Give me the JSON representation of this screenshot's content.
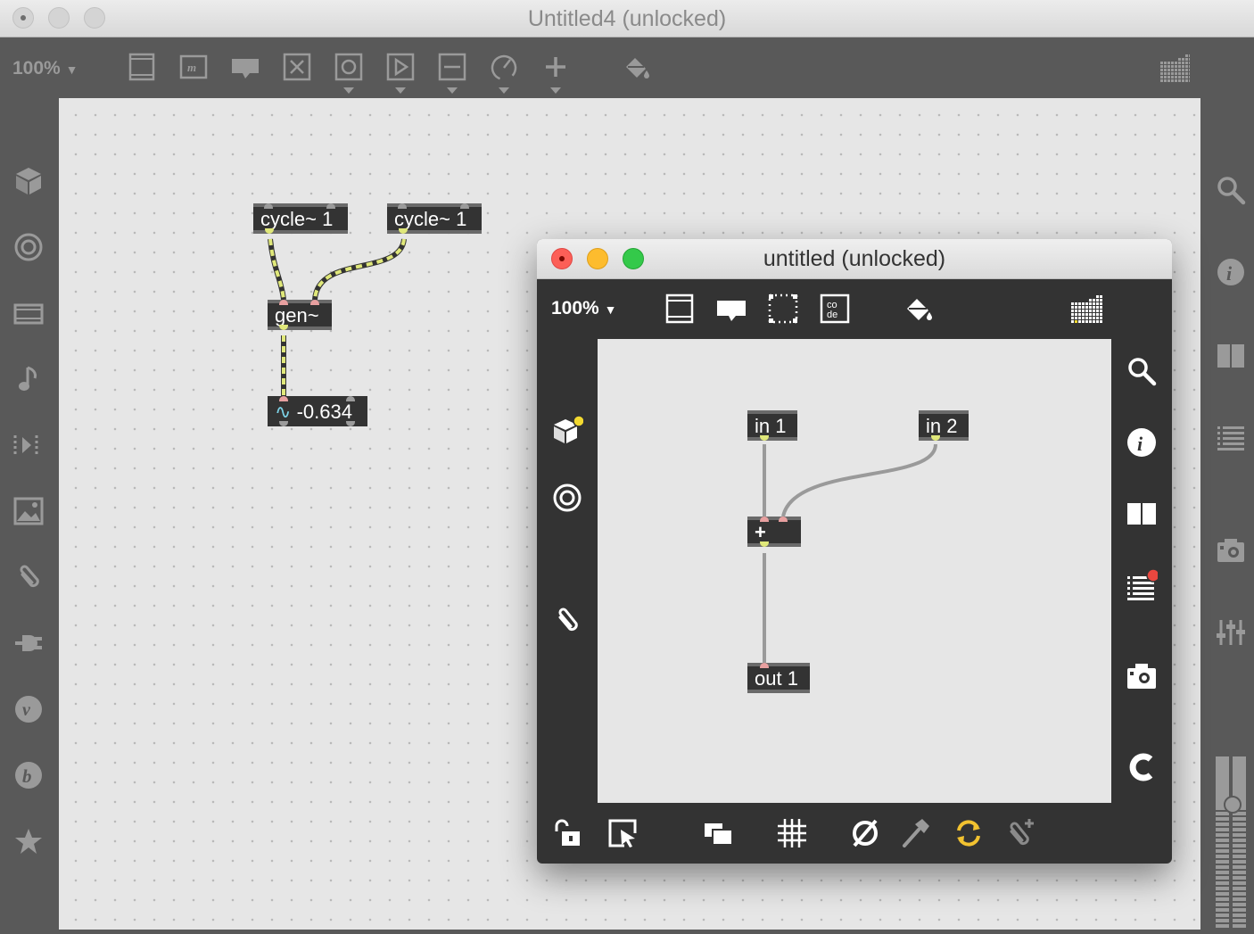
{
  "window": {
    "title": "Untitled4 (unlocked)"
  },
  "toolbar": {
    "zoom": "100%",
    "icons": [
      "presentation-frame-icon",
      "message-box-icon",
      "comment-icon",
      "button-x-icon",
      "toggle-circle-icon",
      "play-icon",
      "slider-icon",
      "dial-icon",
      "plus-icon",
      "paint-bucket-icon",
      "grid-pattern-icon"
    ]
  },
  "left_sidebar": {
    "icons": [
      "cube-icon",
      "target-icon",
      "media-player-icon",
      "music-note-icon",
      "skip-frames-icon",
      "image-icon",
      "paperclip-icon",
      "plug-icon",
      "vst-v-icon",
      "beap-b-icon",
      "star-icon"
    ]
  },
  "right_sidebar": {
    "icons": [
      "search-icon",
      "info-icon",
      "split-view-icon",
      "list-icon",
      "camera-icon",
      "mixer-icon",
      "level-meter-icon"
    ]
  },
  "patch": {
    "objects": [
      {
        "id": "cycle1",
        "text": "cycle~ 1"
      },
      {
        "id": "cycle2",
        "text": "cycle~ 1"
      },
      {
        "id": "gen",
        "text": "gen~"
      },
      {
        "id": "number",
        "text": "-0.634"
      }
    ]
  },
  "subwindow": {
    "title": "untitled (unlocked)",
    "zoom": "100%",
    "toolbar_icons": [
      "presentation-frame-icon",
      "comment-icon",
      "dotted-box-icon",
      "codebox-icon",
      "paint-bucket-icon",
      "grid-pattern-icon"
    ],
    "codebox_label": "co de",
    "left_icons": [
      "cube-icon",
      "target-icon",
      "paperclip-icon"
    ],
    "right_icons": [
      "search-icon",
      "info-icon",
      "split-view-icon",
      "list-icon",
      "camera-icon",
      "c-icon"
    ],
    "bottom_icons": [
      "lock-icon",
      "select-pointer-icon",
      "windows-icon",
      "grid-icon",
      "mute-icon",
      "hammer-icon",
      "refresh-icon",
      "add-paperclip-icon"
    ],
    "objects": [
      {
        "id": "in1",
        "text": "in 1"
      },
      {
        "id": "in2",
        "text": "in 2"
      },
      {
        "id": "plus",
        "text": "+"
      },
      {
        "id": "out1",
        "text": "out 1"
      }
    ]
  },
  "colors": {
    "patch_cord": "#e0e87a",
    "cord_dark": "#333333",
    "sub_cord": "#9a9a9a",
    "notify_yellow": "#f2d930",
    "notify_red": "#e8473f"
  }
}
